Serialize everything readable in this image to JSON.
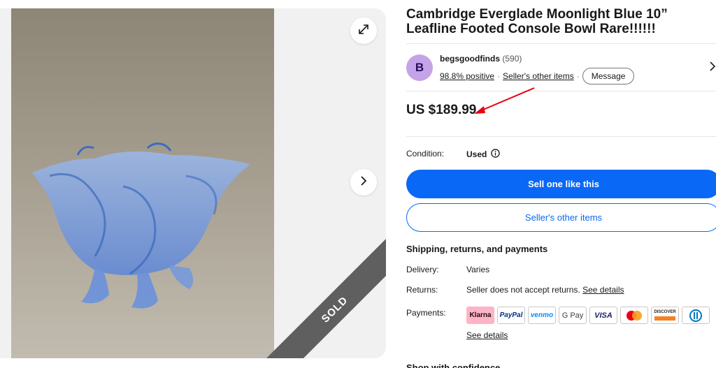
{
  "gallery": {
    "sold_label": "SOLD"
  },
  "listing": {
    "title": "Cambridge Everglade Moonlight Blue 10” Leafline Footed Console Bowl Rare!!!!!!",
    "price": "US $189.99"
  },
  "seller": {
    "avatar_letter": "B",
    "name": "begsgoodfinds",
    "feedback_count": "(590)",
    "positive": "98.8% positive",
    "other_items_link": "Seller's other items",
    "message_label": "Message"
  },
  "condition": {
    "label": "Condition:",
    "value": "Used"
  },
  "actions": {
    "primary": "Sell one like this",
    "secondary": "Seller's other items"
  },
  "shipping": {
    "heading": "Shipping, returns, and payments",
    "delivery_label": "Delivery:",
    "delivery_value": "Varies",
    "returns_label": "Returns:",
    "returns_value": "Seller does not accept returns.",
    "returns_link": "See details",
    "payments_label": "Payments:",
    "payments_link": "See details",
    "methods": [
      "Klarna",
      "PayPal",
      "venmo",
      "G Pay",
      "VISA",
      "Mastercard",
      "DISCOVER",
      "Diners Club"
    ]
  },
  "next_section": {
    "partial_heading": "Shop with confidence"
  },
  "colors": {
    "primary_blue": "#0968f6",
    "avatar_bg": "#c5a3e8",
    "annotation_red": "#e8000e",
    "klarna_pink": "#ffb3c7"
  }
}
